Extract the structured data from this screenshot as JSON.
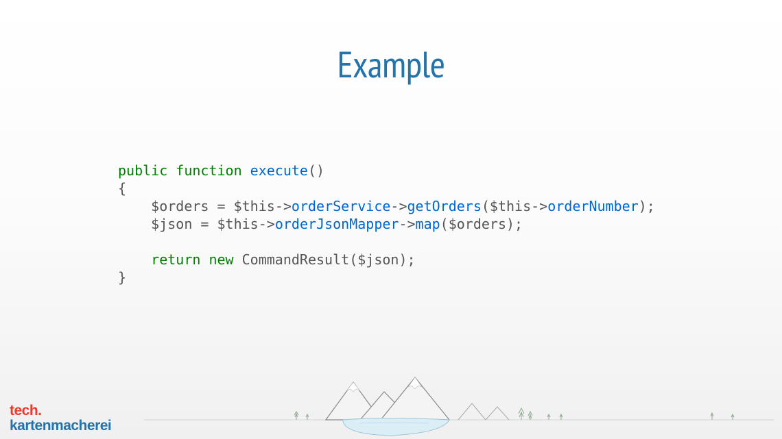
{
  "title": "Example",
  "code": {
    "l1_kw1": "public",
    "l1_kw2": "function",
    "l1_fn": "execute",
    "l1_paren": "()",
    "l2_brace": "{",
    "l3_indent": "    ",
    "l3_var1": "$orders",
    "l3_assign": " = ",
    "l3_this1": "$this",
    "l3_arrow1": "->",
    "l3_mem1": "orderService",
    "l3_arrow2": "->",
    "l3_mem2": "getOrders",
    "l3_p1": "(",
    "l3_this2": "$this",
    "l3_arrow3": "->",
    "l3_mem3": "orderNumber",
    "l3_p2": ");",
    "l4_indent": "    ",
    "l4_var1": "$json",
    "l4_assign": " = ",
    "l4_this": "$this",
    "l4_arrow1": "->",
    "l4_mem1": "orderJsonMapper",
    "l4_arrow2": "->",
    "l4_mem2": "map",
    "l4_p1": "(",
    "l4_var2": "$orders",
    "l4_p2": ");",
    "l6_indent": "    ",
    "l6_kw1": "return",
    "l6_kw2": "new",
    "l6_class": "CommandResult",
    "l6_p1": "(",
    "l6_var": "$json",
    "l6_p2": ");",
    "l7_brace": "}"
  },
  "logo": {
    "top": "tech.",
    "bottom": "kartenmacherei"
  }
}
